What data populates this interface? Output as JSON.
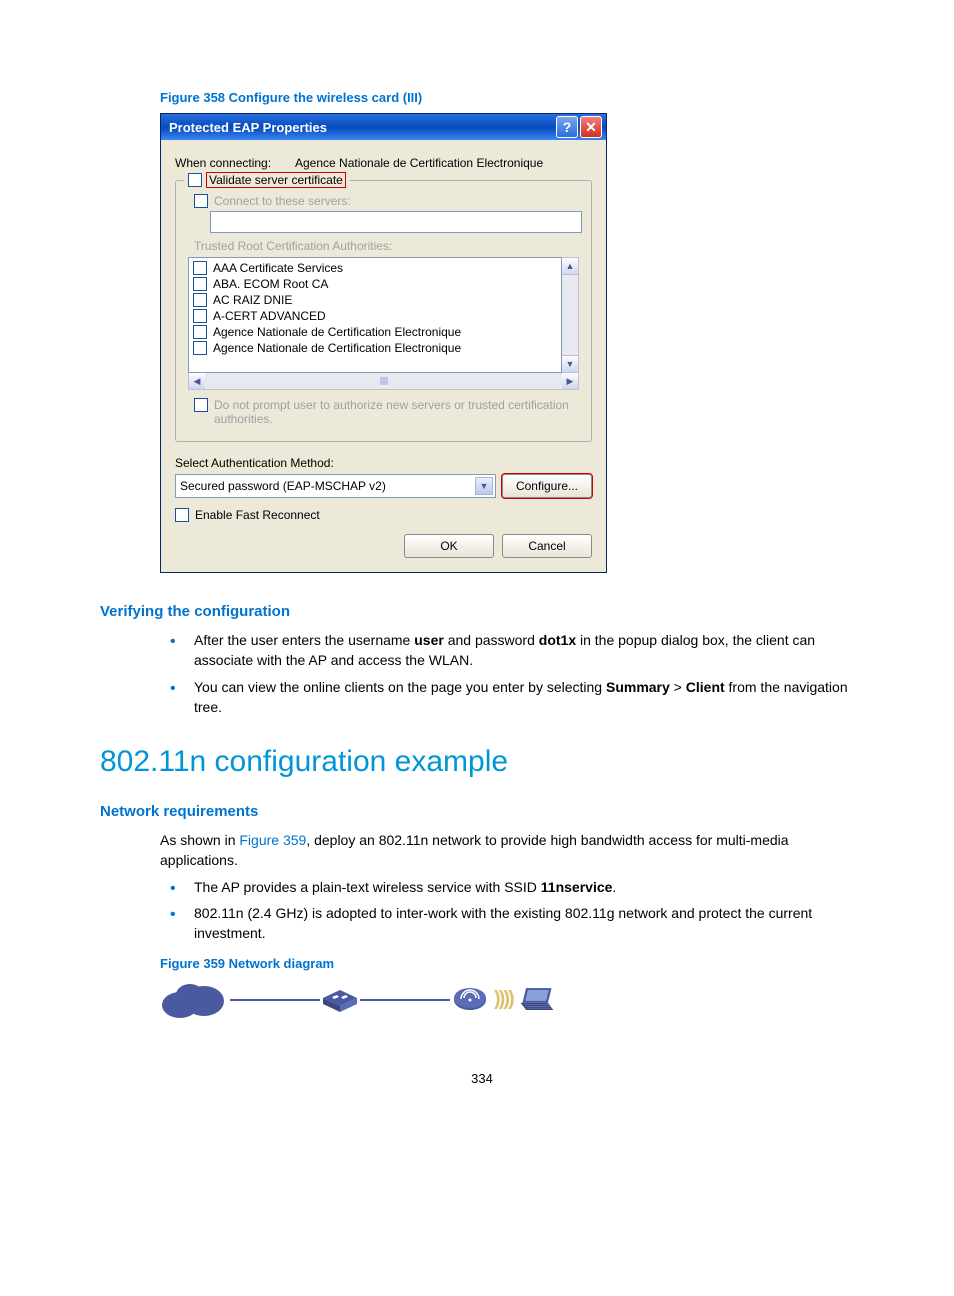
{
  "figure358_caption": "Figure 358 Configure the wireless card (III)",
  "dialog": {
    "title": "Protected EAP Properties",
    "when_connecting_label": "When connecting:",
    "when_connecting_value": "Agence Nationale de Certification Electronique",
    "validate_server_cert": "Validate server certificate",
    "connect_to_servers": "Connect to these servers:",
    "trusted_root_label": "Trusted Root Certification Authorities:",
    "ca_items": [
      "AAA Certificate Services",
      "ABA. ECOM Root CA",
      "AC RAIZ DNIE",
      "A-CERT ADVANCED",
      "Agence Nationale de Certification Electronique",
      "Agence Nationale de Certification Electronique"
    ],
    "do_not_prompt": "Do not prompt user to authorize new servers or trusted certification authorities.",
    "select_auth_label": "Select Authentication Method:",
    "auth_method_value": "Secured password (EAP-MSCHAP v2)",
    "configure_btn": "Configure...",
    "enable_fast_reconnect": "Enable Fast Reconnect",
    "ok_btn": "OK",
    "cancel_btn": "Cancel"
  },
  "verify_heading": "Verifying the configuration",
  "verify_bullets": {
    "b1_pre": "After the user enters the username ",
    "b1_user": "user",
    "b1_mid": " and password ",
    "b1_pass": "dot1x",
    "b1_post": " in the popup dialog box, the client can associate with the AP and access the WLAN.",
    "b2_pre": "You can view the online clients on the page you enter by selecting ",
    "b2_summary": "Summary",
    "b2_gt": " > ",
    "b2_client": "Client",
    "b2_post": " from the navigation tree."
  },
  "h1_title": "802.11n configuration example",
  "netreq_heading": "Network requirements",
  "netreq_para_pre": "As shown in ",
  "netreq_para_link": "Figure 359",
  "netreq_para_post": ", deploy an 802.11n network to provide high bandwidth access for multi-media applications.",
  "netreq_bullets": {
    "b1_pre": "The AP provides a plain-text wireless service with SSID ",
    "b1_ssid": "11nservice",
    "b1_post": ".",
    "b2": "802.11n (2.4 GHz) is adopted to inter-work with the existing 802.11g network and protect the current investment."
  },
  "figure359_caption": "Figure 359 Network diagram",
  "page_number": "334"
}
